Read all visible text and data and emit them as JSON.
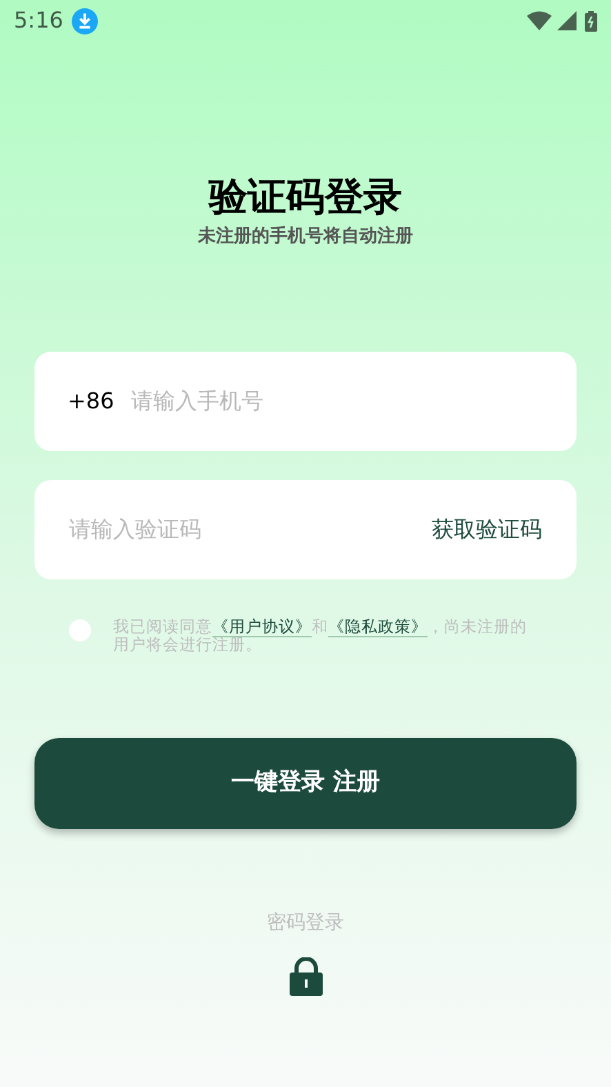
{
  "status_bar": {
    "time": "5:16"
  },
  "title": "验证码登录",
  "subtitle": "未注册的手机号将自动注册",
  "phone_field": {
    "prefix": "+86",
    "placeholder": "请输入手机号"
  },
  "code_field": {
    "placeholder": "请输入验证码",
    "action": "获取验证码"
  },
  "agreement": {
    "checked": false,
    "before": "我已阅读同意",
    "link_1": "《用户协议》",
    "middle": "和",
    "link_2": "《隐私政策》",
    "after": "，尚未注册的用户将会进行注册。"
  },
  "login_button": "一键登录 注册",
  "alt_login": {
    "label": "密码登录"
  }
}
